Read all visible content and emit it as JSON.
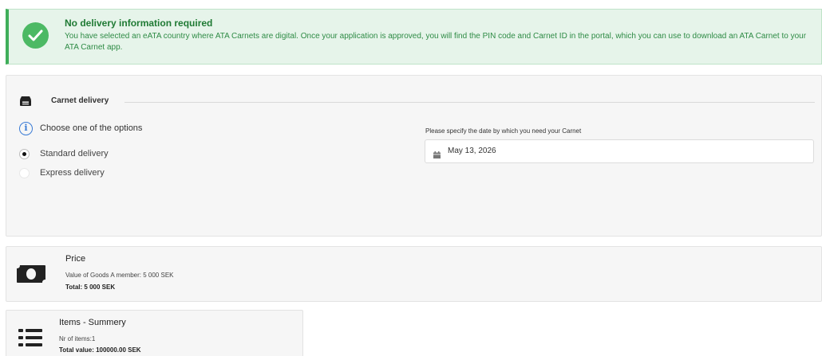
{
  "alert": {
    "title": "No delivery information required",
    "message": "You have selected an eATA country where ATA Carnets are digital. Once your application is approved, you will find the PIN code and Carnet ID in the portal, which you can use to download an ATA Carnet to your ATA Carnet app.",
    "icon": "check-circle-icon",
    "color": "#4cb964"
  },
  "delivery": {
    "section_title": "Carnet delivery",
    "options_label": "Choose one of the options",
    "options": [
      {
        "label": "Standard delivery",
        "selected": true
      },
      {
        "label": "Express delivery",
        "selected": false
      }
    ],
    "date_label": "Please specify the date by which you need your Carnet",
    "date_value": "May 13, 2026"
  },
  "price": {
    "title": "Price",
    "line": "Value of Goods A member: 5 000 SEK",
    "total": "Total: 5 000 SEK"
  },
  "items": {
    "title": "Items - Summery",
    "count": "Nr of items:1",
    "total_value": "Total value: 100000.00 SEK"
  }
}
